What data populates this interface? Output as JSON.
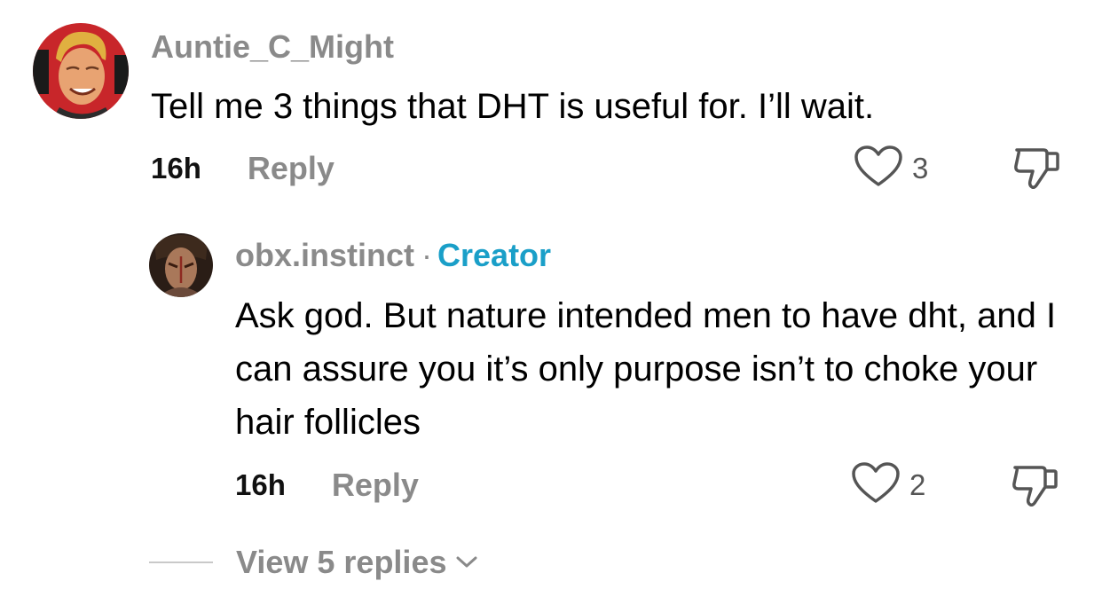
{
  "colors": {
    "username": "#8a8a8a",
    "creator_badge": "#1a9fc8",
    "text": "#000000",
    "muted": "#8a8a8a"
  },
  "comments": [
    {
      "username": "Auntie_C_Might",
      "text": "Tell me 3 things that DHT is useful for. I’ll wait.",
      "time": "16h",
      "reply_label": "Reply",
      "likes": "3"
    },
    {
      "username": "obx.instinct",
      "separator": "·",
      "badge": "Creator",
      "text": "Ask god. But nature intended men to have dht, and I can assure you it’s only purpose isn’t to choke your hair follicles",
      "time": "16h",
      "reply_label": "Reply",
      "likes": "2"
    }
  ],
  "view_replies_label": "View 5 replies",
  "icons": {
    "like": "heart-outline-icon",
    "dislike": "thumbs-down-icon",
    "expand": "chevron-down-icon"
  }
}
